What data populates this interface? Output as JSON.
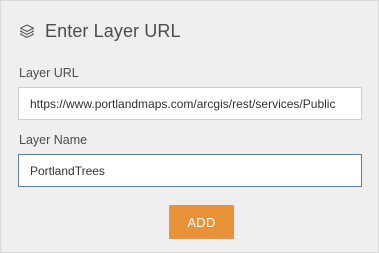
{
  "header": {
    "icon": "layers-icon",
    "title": "Enter Layer URL"
  },
  "layer_url": {
    "label": "Layer URL",
    "value": "https://www.portlandmaps.com/arcgis/rest/services/Public"
  },
  "layer_name": {
    "label": "Layer Name",
    "value": "PortlandTrees"
  },
  "add_button": {
    "label": "ADD"
  },
  "colors": {
    "panel_background": "#efefef",
    "accent_button": "#e8923a",
    "focused_border": "#5d7fa6",
    "text": "#4c4c4c"
  }
}
